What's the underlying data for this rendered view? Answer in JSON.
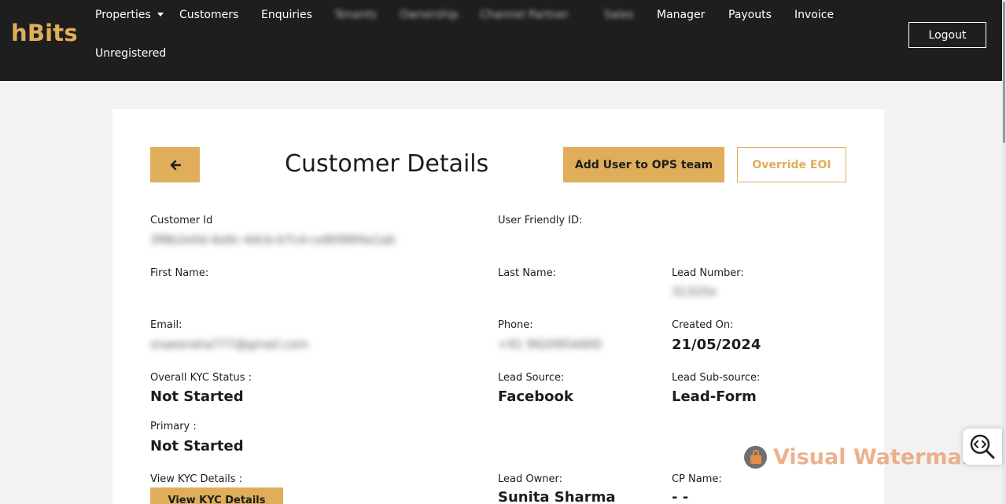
{
  "brand": {
    "logo": "hBits"
  },
  "nav": {
    "items": [
      {
        "label": "Properties",
        "dropdown": true
      },
      {
        "label": "Customers"
      },
      {
        "label": "Enquiries"
      },
      {
        "label": "Tenants"
      },
      {
        "label": "Ownership"
      },
      {
        "label": "Channel Partner"
      },
      {
        "label": "Sales"
      },
      {
        "label": "Manager"
      },
      {
        "label": "Payouts"
      },
      {
        "label": "Invoice"
      },
      {
        "label": "Unregistered"
      }
    ],
    "logout_label": "Logout"
  },
  "header": {
    "title": "Customer Details",
    "add_user_label": "Add User to OPS team",
    "override_label": "Override EOI"
  },
  "fields": {
    "customer_id": {
      "label": "Customer Id",
      "value": "3f8b2e0d-4a9c-4dcb-b7cd-ce8099f4a1ab"
    },
    "user_friendly_id": {
      "label": "User Friendly ID:",
      "value": ""
    },
    "first_name": {
      "label": "First Name:",
      "value": ""
    },
    "last_name": {
      "label": "Last Name:",
      "value": ""
    },
    "lead_number": {
      "label": "Lead Number:",
      "value": "31325e"
    },
    "email": {
      "label": "Email:",
      "value": "snaeeraha777@gmail.com"
    },
    "phone": {
      "label": "Phone:",
      "value": "+91 9920954400"
    },
    "created_on": {
      "label": "Created On:",
      "value": "21/05/2024"
    },
    "overall_kyc": {
      "label": "Overall KYC Status :",
      "value": "Not Started"
    },
    "lead_source": {
      "label": "Lead Source:",
      "value": "Facebook"
    },
    "lead_sub_source": {
      "label": "Lead Sub-source:",
      "value": "Lead-Form"
    },
    "primary": {
      "label": "Primary :",
      "value": "Not Started"
    },
    "view_kyc": {
      "label": "View KYC Details :",
      "button": "View KYC Details"
    },
    "lead_owner": {
      "label": "Lead Owner:",
      "value": "Sunita Sharma"
    },
    "cp_name": {
      "label": "CP Name:",
      "value": "- -"
    }
  },
  "watermark": {
    "text": "Visual Watermark"
  },
  "colors": {
    "accent": "#e0ae5a",
    "navbar": "#1e1e1e",
    "background": "#f2f2f2"
  }
}
